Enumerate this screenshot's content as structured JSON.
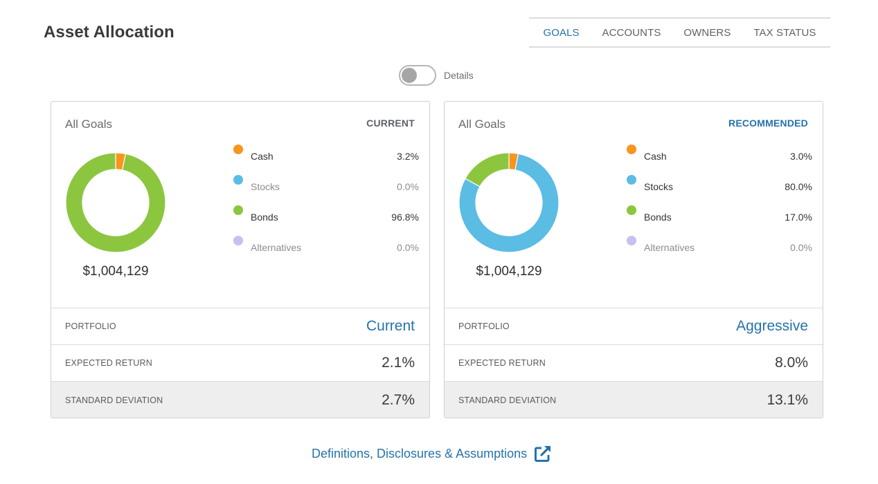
{
  "header": {
    "title": "Asset Allocation",
    "tabs": [
      {
        "label": "GOALS",
        "active": true
      },
      {
        "label": "ACCOUNTS",
        "active": false
      },
      {
        "label": "OWNERS",
        "active": false
      },
      {
        "label": "TAX STATUS",
        "active": false
      }
    ]
  },
  "details_toggle": {
    "label": "Details",
    "on": false
  },
  "colors": {
    "Cash": "#f7951d",
    "Stocks": "#5bbce4",
    "Bonds": "#8cc63f",
    "Alternatives": "#c7c0f0",
    "accent": "#2473ab"
  },
  "cards": [
    {
      "goal": "All Goals",
      "mode": "CURRENT",
      "total": "$1,004,129",
      "allocation": [
        {
          "name": "Cash",
          "value": 3.2,
          "label": "3.2%"
        },
        {
          "name": "Stocks",
          "value": 0.0,
          "label": "0.0%"
        },
        {
          "name": "Bonds",
          "value": 96.8,
          "label": "96.8%"
        },
        {
          "name": "Alternatives",
          "value": 0.0,
          "label": "0.0%"
        }
      ],
      "stats": {
        "portfolio_label": "PORTFOLIO",
        "portfolio_value": "Current",
        "expected_return_label": "EXPECTED RETURN",
        "expected_return_value": "2.1%",
        "std_dev_label": "STANDARD DEVIATION",
        "std_dev_value": "2.7%"
      }
    },
    {
      "goal": "All Goals",
      "mode": "RECOMMENDED",
      "total": "$1,004,129",
      "allocation": [
        {
          "name": "Cash",
          "value": 3.0,
          "label": "3.0%"
        },
        {
          "name": "Stocks",
          "value": 80.0,
          "label": "80.0%"
        },
        {
          "name": "Bonds",
          "value": 17.0,
          "label": "17.0%"
        },
        {
          "name": "Alternatives",
          "value": 0.0,
          "label": "0.0%"
        }
      ],
      "stats": {
        "portfolio_label": "PORTFOLIO",
        "portfolio_value": "Aggressive",
        "expected_return_label": "EXPECTED RETURN",
        "expected_return_value": "8.0%",
        "std_dev_label": "STANDARD DEVIATION",
        "std_dev_value": "13.1%"
      }
    }
  ],
  "footer": {
    "link_label": "Definitions, Disclosures & Assumptions",
    "icon": "external-link-icon"
  }
}
